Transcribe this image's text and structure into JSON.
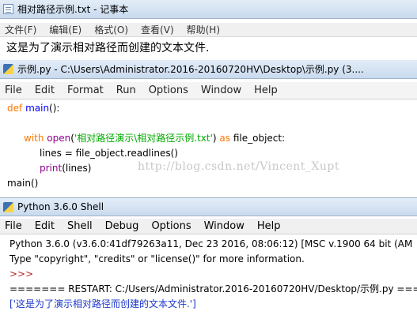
{
  "notepad": {
    "title": "相对路径示例.txt - 记事本",
    "menu": [
      "文件(F)",
      "编辑(E)",
      "格式(O)",
      "查看(V)",
      "帮助(H)"
    ],
    "content": "这是为了演示相对路径而创建的文本文件."
  },
  "idle_editor": {
    "title": "示例.py - C:\\Users\\Administrator.2016-20160720HV\\Desktop\\示例.py (3....",
    "menu": [
      "File",
      "Edit",
      "Format",
      "Run",
      "Options",
      "Window",
      "Help"
    ],
    "code": {
      "l1_kw": "def",
      "l1_fn": "main",
      "l1_rest": "():",
      "l2_kw": "with",
      "l2_bi": "open",
      "l2_p1": "(",
      "l2_str": "'相对路径演示\\相对路径示例.txt'",
      "l2_p2": ")",
      "l2_as": "as",
      "l2_rest": "file_object:",
      "l3": "lines = file_object.readlines()",
      "l4_bi": "print",
      "l4_rest": "(lines)",
      "l5": "main()"
    },
    "watermark": "http://blog.csdn.net/Vincent_Xupt"
  },
  "shell": {
    "title": "Python 3.6.0 Shell",
    "menu": [
      "File",
      "Edit",
      "Shell",
      "Debug",
      "Options",
      "Window",
      "Help"
    ],
    "lines": {
      "banner": "Python 3.6.0 (v3.6.0:41df79263a11, Dec 23 2016, 08:06:12) [MSC v.1900 64 bit (AM",
      "info": "Type \"copyright\", \"credits\" or \"license()\" for more information.",
      "prompt": ">>>",
      "restart": "======= RESTART: C:/Users/Administrator.2016-20160720HV/Desktop/示例.py ====",
      "output": "['这是为了演示相对路径而创建的文本文件.']"
    }
  }
}
